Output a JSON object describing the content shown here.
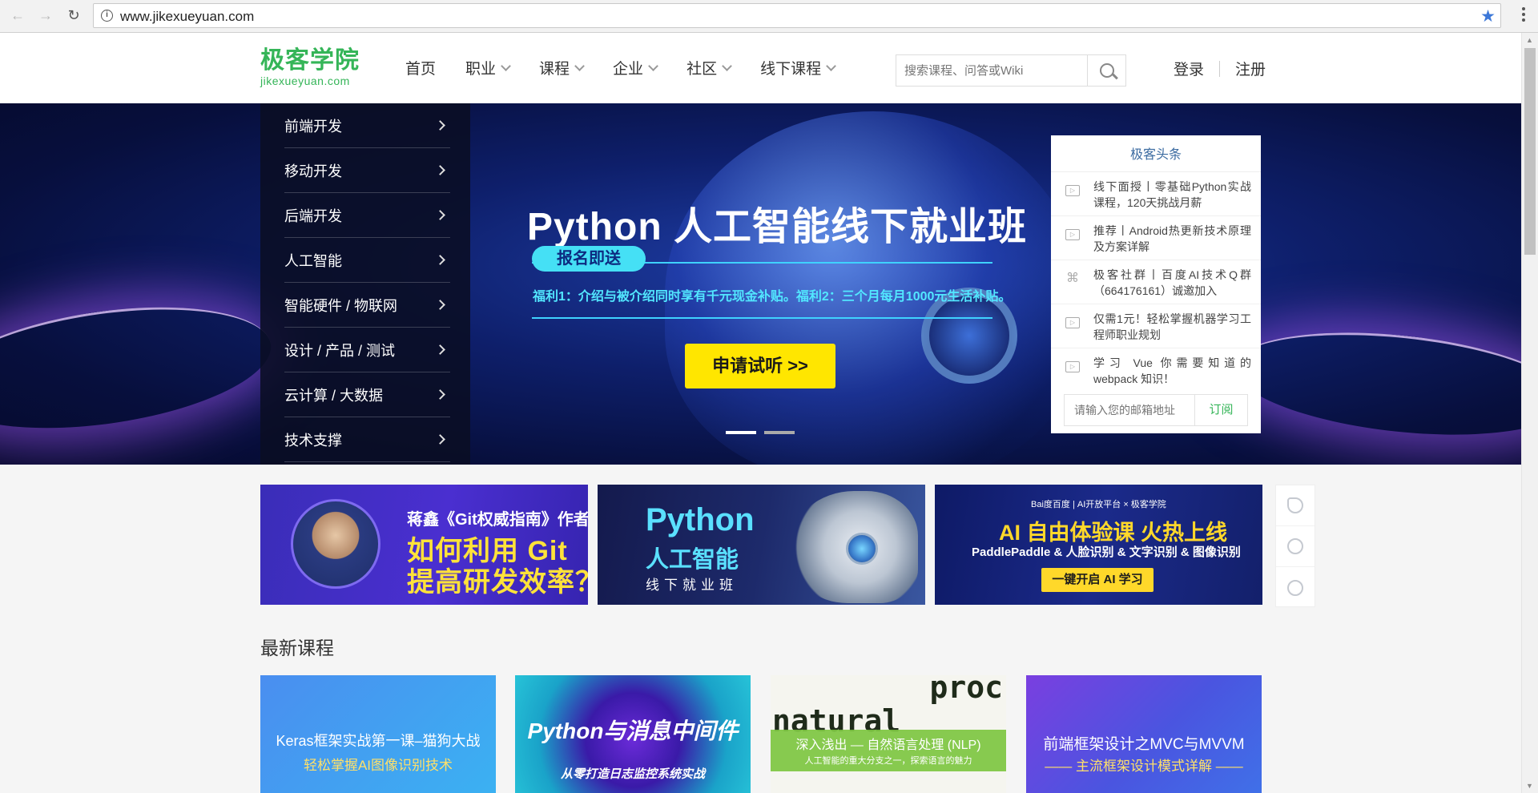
{
  "browser": {
    "url": "www.jikexueyuan.com",
    "icons": [
      "back-icon",
      "forward-icon",
      "reload-icon",
      "info-icon",
      "bookmark-star-icon",
      "menu-dots-icon"
    ]
  },
  "header": {
    "logo_cn": "极客学院",
    "logo_en": "jikexueyuan.com",
    "nav": [
      {
        "label": "首页",
        "has_dropdown": false
      },
      {
        "label": "职业",
        "has_dropdown": true
      },
      {
        "label": "课程",
        "has_dropdown": true
      },
      {
        "label": "企业",
        "has_dropdown": true
      },
      {
        "label": "社区",
        "has_dropdown": true
      },
      {
        "label": "线下课程",
        "has_dropdown": true
      }
    ],
    "search_placeholder": "搜索课程、问答或Wiki",
    "login": "登录",
    "register": "注册",
    "brand_color": "#35b558"
  },
  "categories": [
    "前端开发",
    "移动开发",
    "后端开发",
    "人工智能",
    "智能硬件 / 物联网",
    "设计 / 产品 / 测试",
    "云计算 / 大数据",
    "技术支撑"
  ],
  "banner": {
    "title": "Python 人工智能线下就业班",
    "pill": "报名即送",
    "benefits": "福利1：介绍与被介绍同时享有千元现金补贴。福利2：三个月每月1000元生活补贴。",
    "cta": "申请试听 >>",
    "slide_count": 2,
    "active_slide": 1
  },
  "news": {
    "title": "极客头条",
    "items": [
      {
        "icon": "video-icon",
        "text": "线下面授丨零基础Python实战课程，120天挑战月薪"
      },
      {
        "icon": "video-icon",
        "text": "推荐丨Android热更新技术原理及方案详解"
      },
      {
        "icon": "command-icon",
        "text": "极客社群丨百度AI技术Q群（664176161）诚邀加入"
      },
      {
        "icon": "video-icon",
        "text": "仅需1元！轻松掌握机器学习工程师职业规划"
      },
      {
        "icon": "video-icon",
        "text": "学习 Vue 你需要知道的 webpack 知识！"
      }
    ],
    "email_placeholder": "请输入您的邮箱地址",
    "subscribe": "订阅"
  },
  "promos": [
    {
      "line1": "蒋鑫《Git权威指南》作者",
      "line2": "如何利用 Git",
      "line3": "提高研发效率？"
    },
    {
      "line1": "Python",
      "line2": "人工智能",
      "line3": "线下就业班"
    },
    {
      "logos": "Bai度百度 | AI开放平台  ×  极客学院",
      "line1": "AI 自由体验课 火热上线",
      "line2": "PaddlePaddle & 人脸识别 & 文字识别 & 图像识别",
      "button": "一键开启 AI 学习"
    }
  ],
  "side_tools": [
    "phone-icon",
    "customer-service-icon",
    "feedback-chat-icon"
  ],
  "latest": {
    "title": "最新课程",
    "courses": [
      {
        "line1": "Keras框架实战第一课–猫狗大战",
        "line2": "轻松掌握AI图像识别技术"
      },
      {
        "line1": "Python与消息中间件",
        "line2": "从零打造日志监控系统实战"
      },
      {
        "words_top": "proc",
        "words_mid": "natural",
        "line1": "深入浅出 — 自然语言处理 (NLP)",
        "line2": "人工智能的重大分支之一，探索语言的魅力"
      },
      {
        "line1": "前端框架设计之MVC与MVVM",
        "line2": "—— 主流框架设计模式详解 ——"
      }
    ]
  }
}
